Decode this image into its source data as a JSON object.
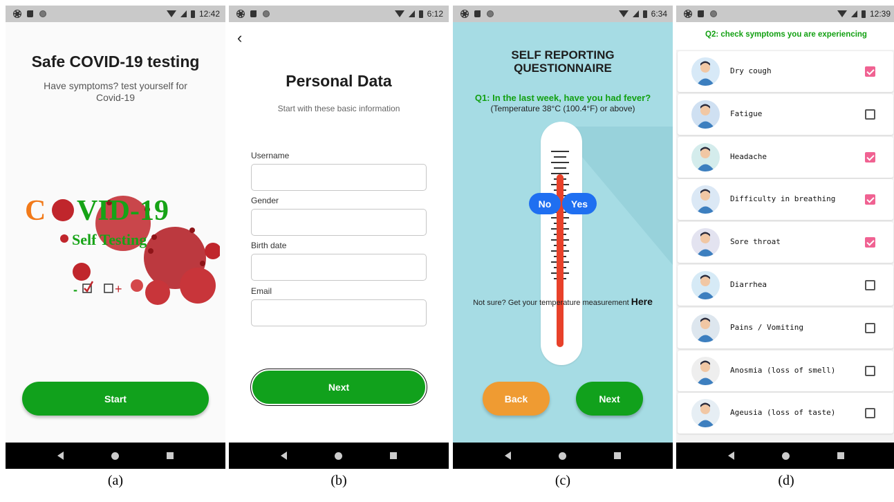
{
  "screens": [
    {
      "status_time": "12:42",
      "caption": "(a)",
      "title": "Safe COVID-19 testing",
      "subtitle": "Have symptoms? test yourself for Covid-19",
      "logo": {
        "word1": "C",
        "word2": "VID-19",
        "tag": "Self Testing",
        "minus": "-",
        "plus": "+"
      },
      "start_label": "Start"
    },
    {
      "status_time": "6:12",
      "caption": "(b)",
      "back_glyph": "‹",
      "title": "Personal Data",
      "subtitle": "Start with these basic information",
      "fields": [
        {
          "label": "Username",
          "value": ""
        },
        {
          "label": "Gender",
          "value": ""
        },
        {
          "label": "Birth date",
          "value": ""
        },
        {
          "label": "Email",
          "value": ""
        }
      ],
      "next_label": "Next"
    },
    {
      "status_time": "6:34",
      "caption": "(c)",
      "title_line1": "SELF REPORTING",
      "title_line2": "QUESTIONNAIRE",
      "question": "Q1: In the last week, have you had fever?",
      "question_sub": "(Temperature 38°C (100.4°F) or above)",
      "no_label": "No",
      "yes_label": "Yes",
      "not_sure": "Not sure? Get your temperature measurement",
      "here_label": "Here",
      "back_label": "Back",
      "next_label": "Next"
    },
    {
      "status_time": "12:39",
      "caption": "(d)",
      "header": "Q2: check symptoms you are experiencing",
      "symptoms": [
        {
          "label": "Dry cough",
          "checked": true,
          "icon": "dry-cough-icon"
        },
        {
          "label": "Fatigue",
          "checked": false,
          "icon": "fatigue-icon"
        },
        {
          "label": "Headache",
          "checked": true,
          "icon": "headache-icon"
        },
        {
          "label": "Difficulty in breathing",
          "checked": true,
          "icon": "breathing-icon"
        },
        {
          "label": "Sore throat",
          "checked": true,
          "icon": "sore-throat-icon"
        },
        {
          "label": "Diarrhea",
          "checked": false,
          "icon": "diarrhea-icon"
        },
        {
          "label": "Pains / Vomiting",
          "checked": false,
          "icon": "vomiting-icon"
        },
        {
          "label": "Anosmia (loss of smell)",
          "checked": false,
          "icon": "anosmia-icon"
        },
        {
          "label": "Ageusia (loss of taste)",
          "checked": false,
          "icon": "ageusia-icon"
        }
      ]
    }
  ],
  "colors": {
    "green": "#11a11c",
    "blue": "#1f6ff1",
    "orange": "#ef9b32",
    "pink": "#f06292",
    "teal_bg": "#a6dce4"
  }
}
